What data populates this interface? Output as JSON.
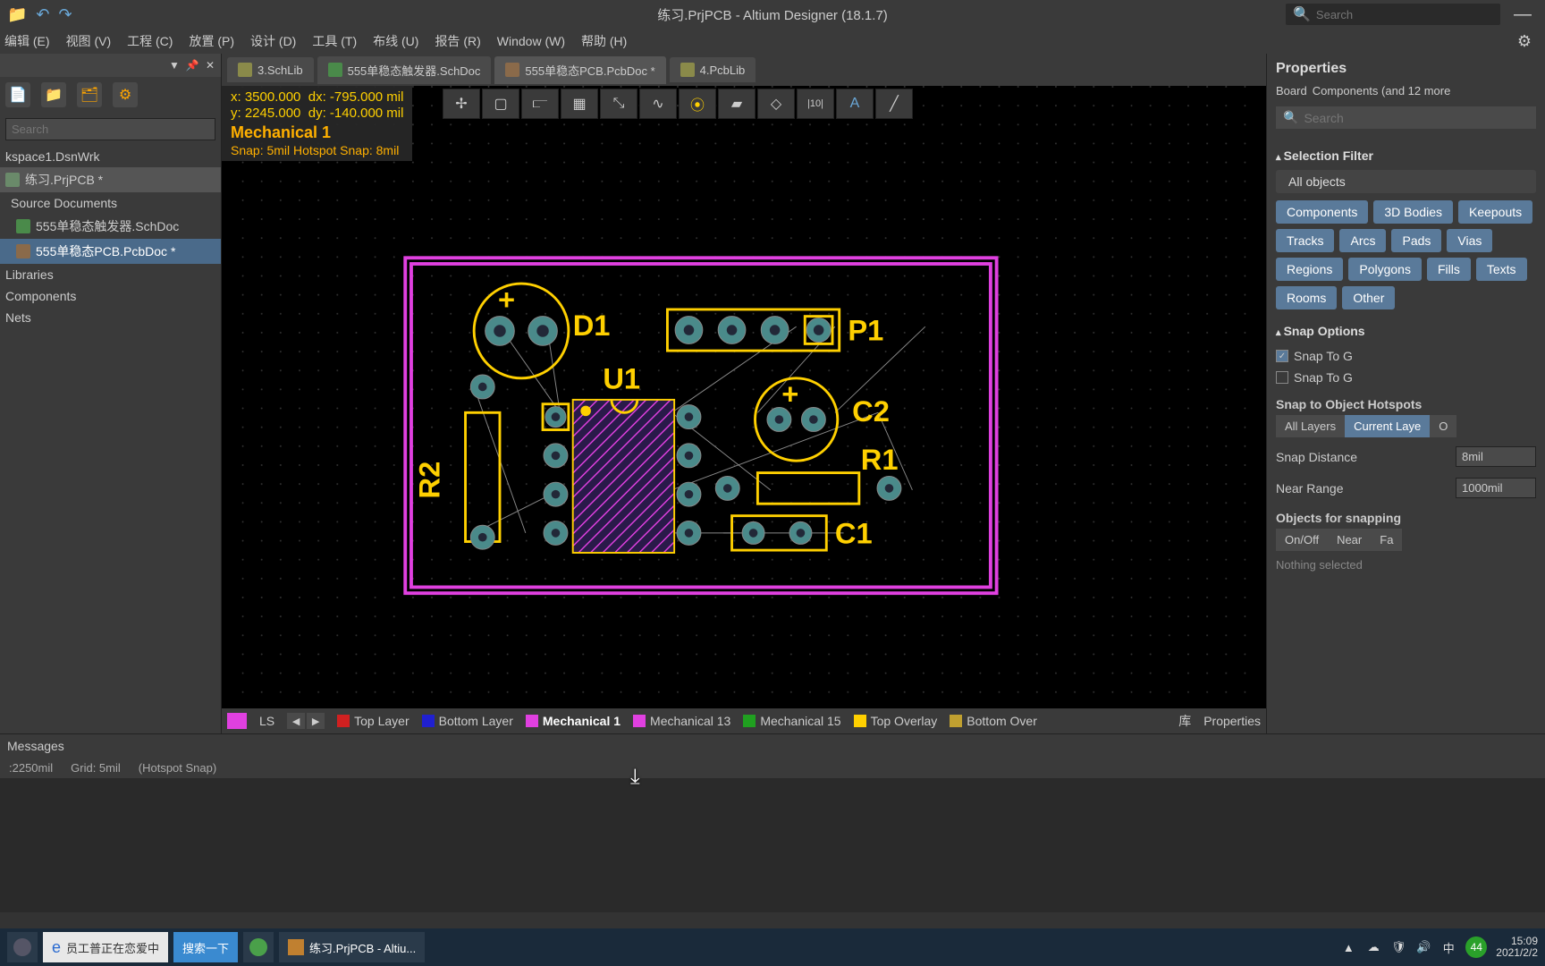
{
  "titlebar": {
    "title": "练习.PrjPCB - Altium Designer (18.1.7)",
    "search_placeholder": "Search"
  },
  "menubar": [
    "编辑 (E)",
    "视图 (V)",
    "工程 (C)",
    "放置 (P)",
    "设计 (D)",
    "工具 (T)",
    "布线 (U)",
    "报告 (R)",
    "Window (W)",
    "帮助 (H)"
  ],
  "left": {
    "search_placeholder": "Search",
    "workspace": "kspace1.DsnWrk",
    "project": "练习.PrjPCB *",
    "src_hdr": "Source Documents",
    "docs": [
      "555单稳态触发器.SchDoc",
      "555单稳态PCB.PcbDoc *"
    ],
    "lib": "Libraries",
    "comp": "Components",
    "nets": "Nets"
  },
  "doctabs": [
    {
      "label": "3.SchLib"
    },
    {
      "label": "555单稳态触发器.SchDoc"
    },
    {
      "label": "555单稳态PCB.PcbDoc *",
      "active": true
    },
    {
      "label": "4.PcbLib"
    }
  ],
  "coord": {
    "x": "x:  3500.000",
    "dx": "dx:  -795.000 mil",
    "y": "y:  2245.000",
    "dy": "dy:  -140.000 mil",
    "layer": "Mechanical 1",
    "snap": "Snap: 5mil Hotspot Snap: 8mil"
  },
  "layertabs": {
    "ls": "LS",
    "items": [
      {
        "color": "#d02020",
        "label": "Top Layer"
      },
      {
        "color": "#2020d0",
        "label": "Bottom Layer"
      },
      {
        "color": "#e040e0",
        "label": "Mechanical 1",
        "active": true
      },
      {
        "color": "#e040e0",
        "label": "Mechanical 13"
      },
      {
        "color": "#20a020",
        "label": "Mechanical 15"
      },
      {
        "color": "#ffd000",
        "label": "Top Overlay"
      },
      {
        "color": "#c0a030",
        "label": "Bottom Over"
      }
    ],
    "lib_tab": "库",
    "prop_tab": "Properties"
  },
  "statusbar": {
    "coord": ":2250mil",
    "grid": "Grid: 5mil",
    "snap": "(Hotspot Snap)"
  },
  "messages": "Messages",
  "properties": {
    "title": "Properties",
    "context_a": "Board",
    "context_b": "Components (and 12 more",
    "search_placeholder": "Search",
    "sec_filter": "Selection Filter",
    "all_objects": "All objects",
    "filters": [
      "Components",
      "3D Bodies",
      "Keepouts",
      "Tracks",
      "Arcs",
      "Pads",
      "Vias",
      "Regions",
      "Polygons",
      "Fills",
      "Texts",
      "Rooms",
      "Other"
    ],
    "sec_snap": "Snap Options",
    "snap_grid": "Snap To G",
    "snap_guide": "Snap To G",
    "sec_hotspot": "Snap to Object Hotspots",
    "layer_opts": [
      "All Layers",
      "Current Laye",
      "O"
    ],
    "snap_dist_lbl": "Snap Distance",
    "snap_dist_val": "8mil",
    "near_range_lbl": "Near Range",
    "near_range_val": "1000mil",
    "sec_objects": "Objects for snapping",
    "obj_cols": [
      "On/Off",
      "Near",
      "Fa"
    ],
    "nothing": "Nothing selected",
    "right_pill": "Properties"
  },
  "designators": {
    "D1": "D1",
    "U1": "U1",
    "P1": "P1",
    "C1": "C1",
    "C2": "C2",
    "R1": "R1",
    "R2": "R2"
  },
  "taskbar": {
    "ie_text": "员工普正在恋爱中",
    "search_btn": "搜索一下",
    "altium": "练习.PrjPCB - Altiu...",
    "aqi": "44",
    "time": "15:09",
    "date": "2021/2/2"
  }
}
